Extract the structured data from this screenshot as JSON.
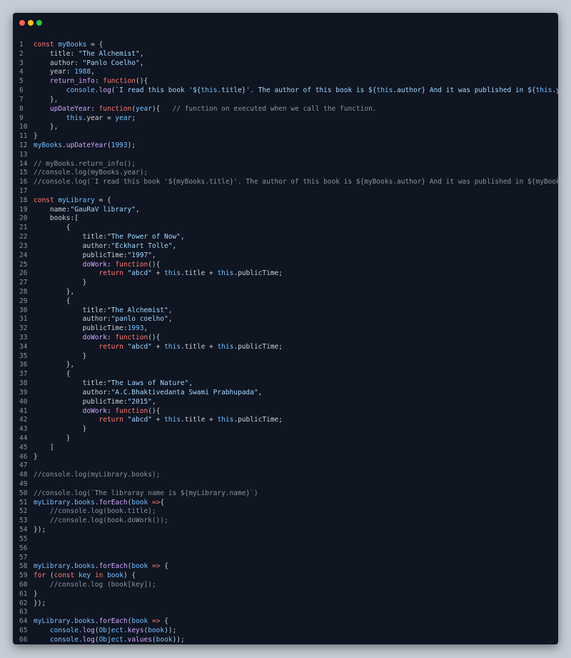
{
  "lines": [
    [
      {
        "t": "const",
        "c": "kw"
      },
      {
        "t": " "
      },
      {
        "t": "myBooks",
        "c": "var"
      },
      {
        "t": " = {"
      }
    ],
    [
      {
        "t": "    title: "
      },
      {
        "t": "\"The Alchemist\"",
        "c": "str"
      },
      {
        "t": ","
      }
    ],
    [
      {
        "t": "    author: "
      },
      {
        "t": "\"Panlo Coelho\"",
        "c": "str"
      },
      {
        "t": ","
      }
    ],
    [
      {
        "t": "    year: "
      },
      {
        "t": "1988",
        "c": "num"
      },
      {
        "t": ","
      }
    ],
    [
      {
        "t": "    "
      },
      {
        "t": "return_info",
        "c": "fn"
      },
      {
        "t": ": "
      },
      {
        "t": "function",
        "c": "kw"
      },
      {
        "t": "(){"
      }
    ],
    [
      {
        "t": "        console.",
        "c": "var"
      },
      {
        "t": "log",
        "c": "fn"
      },
      {
        "t": "(`I read this book '${",
        "c": "str"
      },
      {
        "t": "this",
        "c": "var"
      },
      {
        "t": ".title}'. The author of this book is ${",
        "c": "str"
      },
      {
        "t": "this",
        "c": "var"
      },
      {
        "t": ".author} And it was published in ${",
        "c": "str"
      },
      {
        "t": "this",
        "c": "var"
      },
      {
        "t": ".year}.`",
        "c": "str"
      },
      {
        "t": ");"
      }
    ],
    [
      {
        "t": "    },"
      }
    ],
    [
      {
        "t": "    "
      },
      {
        "t": "upDateYear",
        "c": "fn"
      },
      {
        "t": ": "
      },
      {
        "t": "function",
        "c": "kw"
      },
      {
        "t": "("
      },
      {
        "t": "year",
        "c": "var"
      },
      {
        "t": "){   "
      },
      {
        "t": "// function on executed when we call the function.",
        "c": "cm"
      }
    ],
    [
      {
        "t": "        "
      },
      {
        "t": "this",
        "c": "var"
      },
      {
        "t": ".year = "
      },
      {
        "t": "year",
        "c": "var"
      },
      {
        "t": ";"
      }
    ],
    [
      {
        "t": "    },"
      }
    ],
    [
      {
        "t": "}"
      }
    ],
    [
      {
        "t": "myBooks",
        "c": "var"
      },
      {
        "t": "."
      },
      {
        "t": "upDateYear",
        "c": "fn"
      },
      {
        "t": "("
      },
      {
        "t": "1993",
        "c": "num"
      },
      {
        "t": ");"
      }
    ],
    [],
    [
      {
        "t": "// myBooks.return_info();",
        "c": "cm"
      }
    ],
    [
      {
        "t": "//console.log(myBooks.year);",
        "c": "cm"
      }
    ],
    [
      {
        "t": "//console.log(`I read this book '${myBooks.title}'. The author of this book is ${myBooks.author} And it was published in ${myBooks.year}.`);",
        "c": "cm"
      }
    ],
    [],
    [
      {
        "t": "const",
        "c": "kw"
      },
      {
        "t": " "
      },
      {
        "t": "myLibrary",
        "c": "var"
      },
      {
        "t": " = {"
      }
    ],
    [
      {
        "t": "    name:"
      },
      {
        "t": "\"GauRaV library\"",
        "c": "str"
      },
      {
        "t": ","
      }
    ],
    [
      {
        "t": "    books:["
      }
    ],
    [
      {
        "t": "        {"
      }
    ],
    [
      {
        "t": "            title:"
      },
      {
        "t": "\"The Power of Now\"",
        "c": "str"
      },
      {
        "t": ","
      }
    ],
    [
      {
        "t": "            author:"
      },
      {
        "t": "\"Eckhart Tolle\"",
        "c": "str"
      },
      {
        "t": ","
      }
    ],
    [
      {
        "t": "            publicTime:"
      },
      {
        "t": "\"1997\"",
        "c": "str"
      },
      {
        "t": ","
      }
    ],
    [
      {
        "t": "            "
      },
      {
        "t": "doWork",
        "c": "fn"
      },
      {
        "t": ": "
      },
      {
        "t": "function",
        "c": "kw"
      },
      {
        "t": "(){"
      }
    ],
    [
      {
        "t": "                "
      },
      {
        "t": "return",
        "c": "kw"
      },
      {
        "t": " "
      },
      {
        "t": "\"abcd\"",
        "c": "str"
      },
      {
        "t": " + "
      },
      {
        "t": "this",
        "c": "var"
      },
      {
        "t": ".title + "
      },
      {
        "t": "this",
        "c": "var"
      },
      {
        "t": ".publicTime;"
      }
    ],
    [
      {
        "t": "            }"
      }
    ],
    [
      {
        "t": "        },"
      }
    ],
    [
      {
        "t": "        {"
      }
    ],
    [
      {
        "t": "            title:"
      },
      {
        "t": "\"The Alchemist\"",
        "c": "str"
      },
      {
        "t": ","
      }
    ],
    [
      {
        "t": "            author:"
      },
      {
        "t": "\"panlo coelho\"",
        "c": "str"
      },
      {
        "t": ","
      }
    ],
    [
      {
        "t": "            publicTime:"
      },
      {
        "t": "1993",
        "c": "num"
      },
      {
        "t": ","
      }
    ],
    [
      {
        "t": "            "
      },
      {
        "t": "doWork",
        "c": "fn"
      },
      {
        "t": ": "
      },
      {
        "t": "function",
        "c": "kw"
      },
      {
        "t": "(){"
      }
    ],
    [
      {
        "t": "                "
      },
      {
        "t": "return",
        "c": "kw"
      },
      {
        "t": " "
      },
      {
        "t": "\"abcd\"",
        "c": "str"
      },
      {
        "t": " + "
      },
      {
        "t": "this",
        "c": "var"
      },
      {
        "t": ".title + "
      },
      {
        "t": "this",
        "c": "var"
      },
      {
        "t": ".publicTime;"
      }
    ],
    [
      {
        "t": "            }"
      }
    ],
    [
      {
        "t": "        },"
      }
    ],
    [
      {
        "t": "        {"
      }
    ],
    [
      {
        "t": "            title:"
      },
      {
        "t": "\"The Laws of Nature\"",
        "c": "str"
      },
      {
        "t": ","
      }
    ],
    [
      {
        "t": "            author:"
      },
      {
        "t": "\"A.C.Bhaktivedanta Swami Prabhupada\"",
        "c": "str"
      },
      {
        "t": ","
      }
    ],
    [
      {
        "t": "            publicTime:"
      },
      {
        "t": "\"2015\"",
        "c": "str"
      },
      {
        "t": ","
      }
    ],
    [
      {
        "t": "            "
      },
      {
        "t": "doWork",
        "c": "fn"
      },
      {
        "t": ": "
      },
      {
        "t": "function",
        "c": "kw"
      },
      {
        "t": "(){"
      }
    ],
    [
      {
        "t": "                "
      },
      {
        "t": "return",
        "c": "kw"
      },
      {
        "t": " "
      },
      {
        "t": "\"abcd\"",
        "c": "str"
      },
      {
        "t": " + "
      },
      {
        "t": "this",
        "c": "var"
      },
      {
        "t": ".title + "
      },
      {
        "t": "this",
        "c": "var"
      },
      {
        "t": ".publicTime;"
      }
    ],
    [
      {
        "t": "            }"
      }
    ],
    [
      {
        "t": "        }"
      }
    ],
    [
      {
        "t": "    ]"
      }
    ],
    [
      {
        "t": "}"
      }
    ],
    [],
    [
      {
        "t": "//console.log(myLibrary.books);",
        "c": "cm"
      }
    ],
    [],
    [
      {
        "t": "//console.log(`The libraray name is ${myLibrary.name}`)",
        "c": "cm"
      }
    ],
    [
      {
        "t": "myLibrary",
        "c": "var"
      },
      {
        "t": "."
      },
      {
        "t": "books",
        "c": "var"
      },
      {
        "t": "."
      },
      {
        "t": "forEach",
        "c": "fn"
      },
      {
        "t": "("
      },
      {
        "t": "book",
        "c": "var"
      },
      {
        "t": " "
      },
      {
        "t": "=>",
        "c": "kw"
      },
      {
        "t": "{"
      }
    ],
    [
      {
        "t": "    "
      },
      {
        "t": "//console.log(book.title);",
        "c": "cm"
      }
    ],
    [
      {
        "t": "    "
      },
      {
        "t": "//console.log(book.doWork());",
        "c": "cm"
      }
    ],
    [
      {
        "t": "});"
      }
    ],
    [],
    [],
    [],
    [
      {
        "t": "myLibrary",
        "c": "var"
      },
      {
        "t": "."
      },
      {
        "t": "books",
        "c": "var"
      },
      {
        "t": "."
      },
      {
        "t": "forEach",
        "c": "fn"
      },
      {
        "t": "("
      },
      {
        "t": "book",
        "c": "var"
      },
      {
        "t": " "
      },
      {
        "t": "=>",
        "c": "kw"
      },
      {
        "t": " {"
      }
    ],
    [
      {
        "t": "for",
        "c": "kw"
      },
      {
        "t": " ("
      },
      {
        "t": "const",
        "c": "kw"
      },
      {
        "t": " "
      },
      {
        "t": "key",
        "c": "var"
      },
      {
        "t": " "
      },
      {
        "t": "in",
        "c": "kw"
      },
      {
        "t": " "
      },
      {
        "t": "book",
        "c": "var"
      },
      {
        "t": ") {"
      }
    ],
    [
      {
        "t": "    "
      },
      {
        "t": "//console.log (book[key]);",
        "c": "cm"
      }
    ],
    [
      {
        "t": "}"
      }
    ],
    [
      {
        "t": "});"
      }
    ],
    [],
    [
      {
        "t": "myLibrary",
        "c": "var"
      },
      {
        "t": "."
      },
      {
        "t": "books",
        "c": "var"
      },
      {
        "t": "."
      },
      {
        "t": "forEach",
        "c": "fn"
      },
      {
        "t": "("
      },
      {
        "t": "book",
        "c": "var"
      },
      {
        "t": " "
      },
      {
        "t": "=>",
        "c": "kw"
      },
      {
        "t": " {"
      }
    ],
    [
      {
        "t": "    "
      },
      {
        "t": "console.",
        "c": "var"
      },
      {
        "t": "log",
        "c": "fn"
      },
      {
        "t": "("
      },
      {
        "t": "Object.",
        "c": "var"
      },
      {
        "t": "keys",
        "c": "fn"
      },
      {
        "t": "("
      },
      {
        "t": "book",
        "c": "var"
      },
      {
        "t": "));"
      }
    ],
    [
      {
        "t": "    "
      },
      {
        "t": "console.",
        "c": "var"
      },
      {
        "t": "log",
        "c": "fn"
      },
      {
        "t": "("
      },
      {
        "t": "Object.",
        "c": "var"
      },
      {
        "t": "values",
        "c": "fn"
      },
      {
        "t": "("
      },
      {
        "t": "book",
        "c": "var"
      },
      {
        "t": "));"
      }
    ],
    [
      {
        "t": "})"
      }
    ]
  ]
}
